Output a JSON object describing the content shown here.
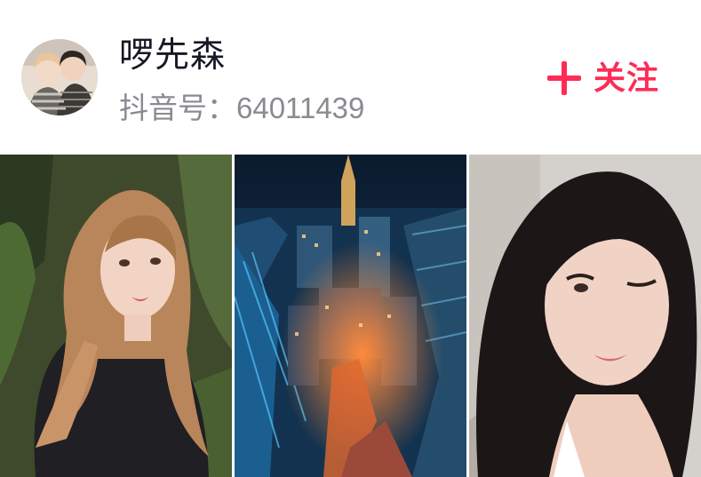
{
  "user": {
    "name": "啰先森",
    "id_label": "抖音号：64011439",
    "avatar_icon": "avatar-photo"
  },
  "follow": {
    "label": "关注",
    "icon": "plus-icon",
    "color": "#fe2c55"
  },
  "gallery": {
    "items": [
      {
        "icon": "portrait-photo"
      },
      {
        "icon": "city-night-photo"
      },
      {
        "icon": "portrait-wink-photo"
      }
    ]
  }
}
